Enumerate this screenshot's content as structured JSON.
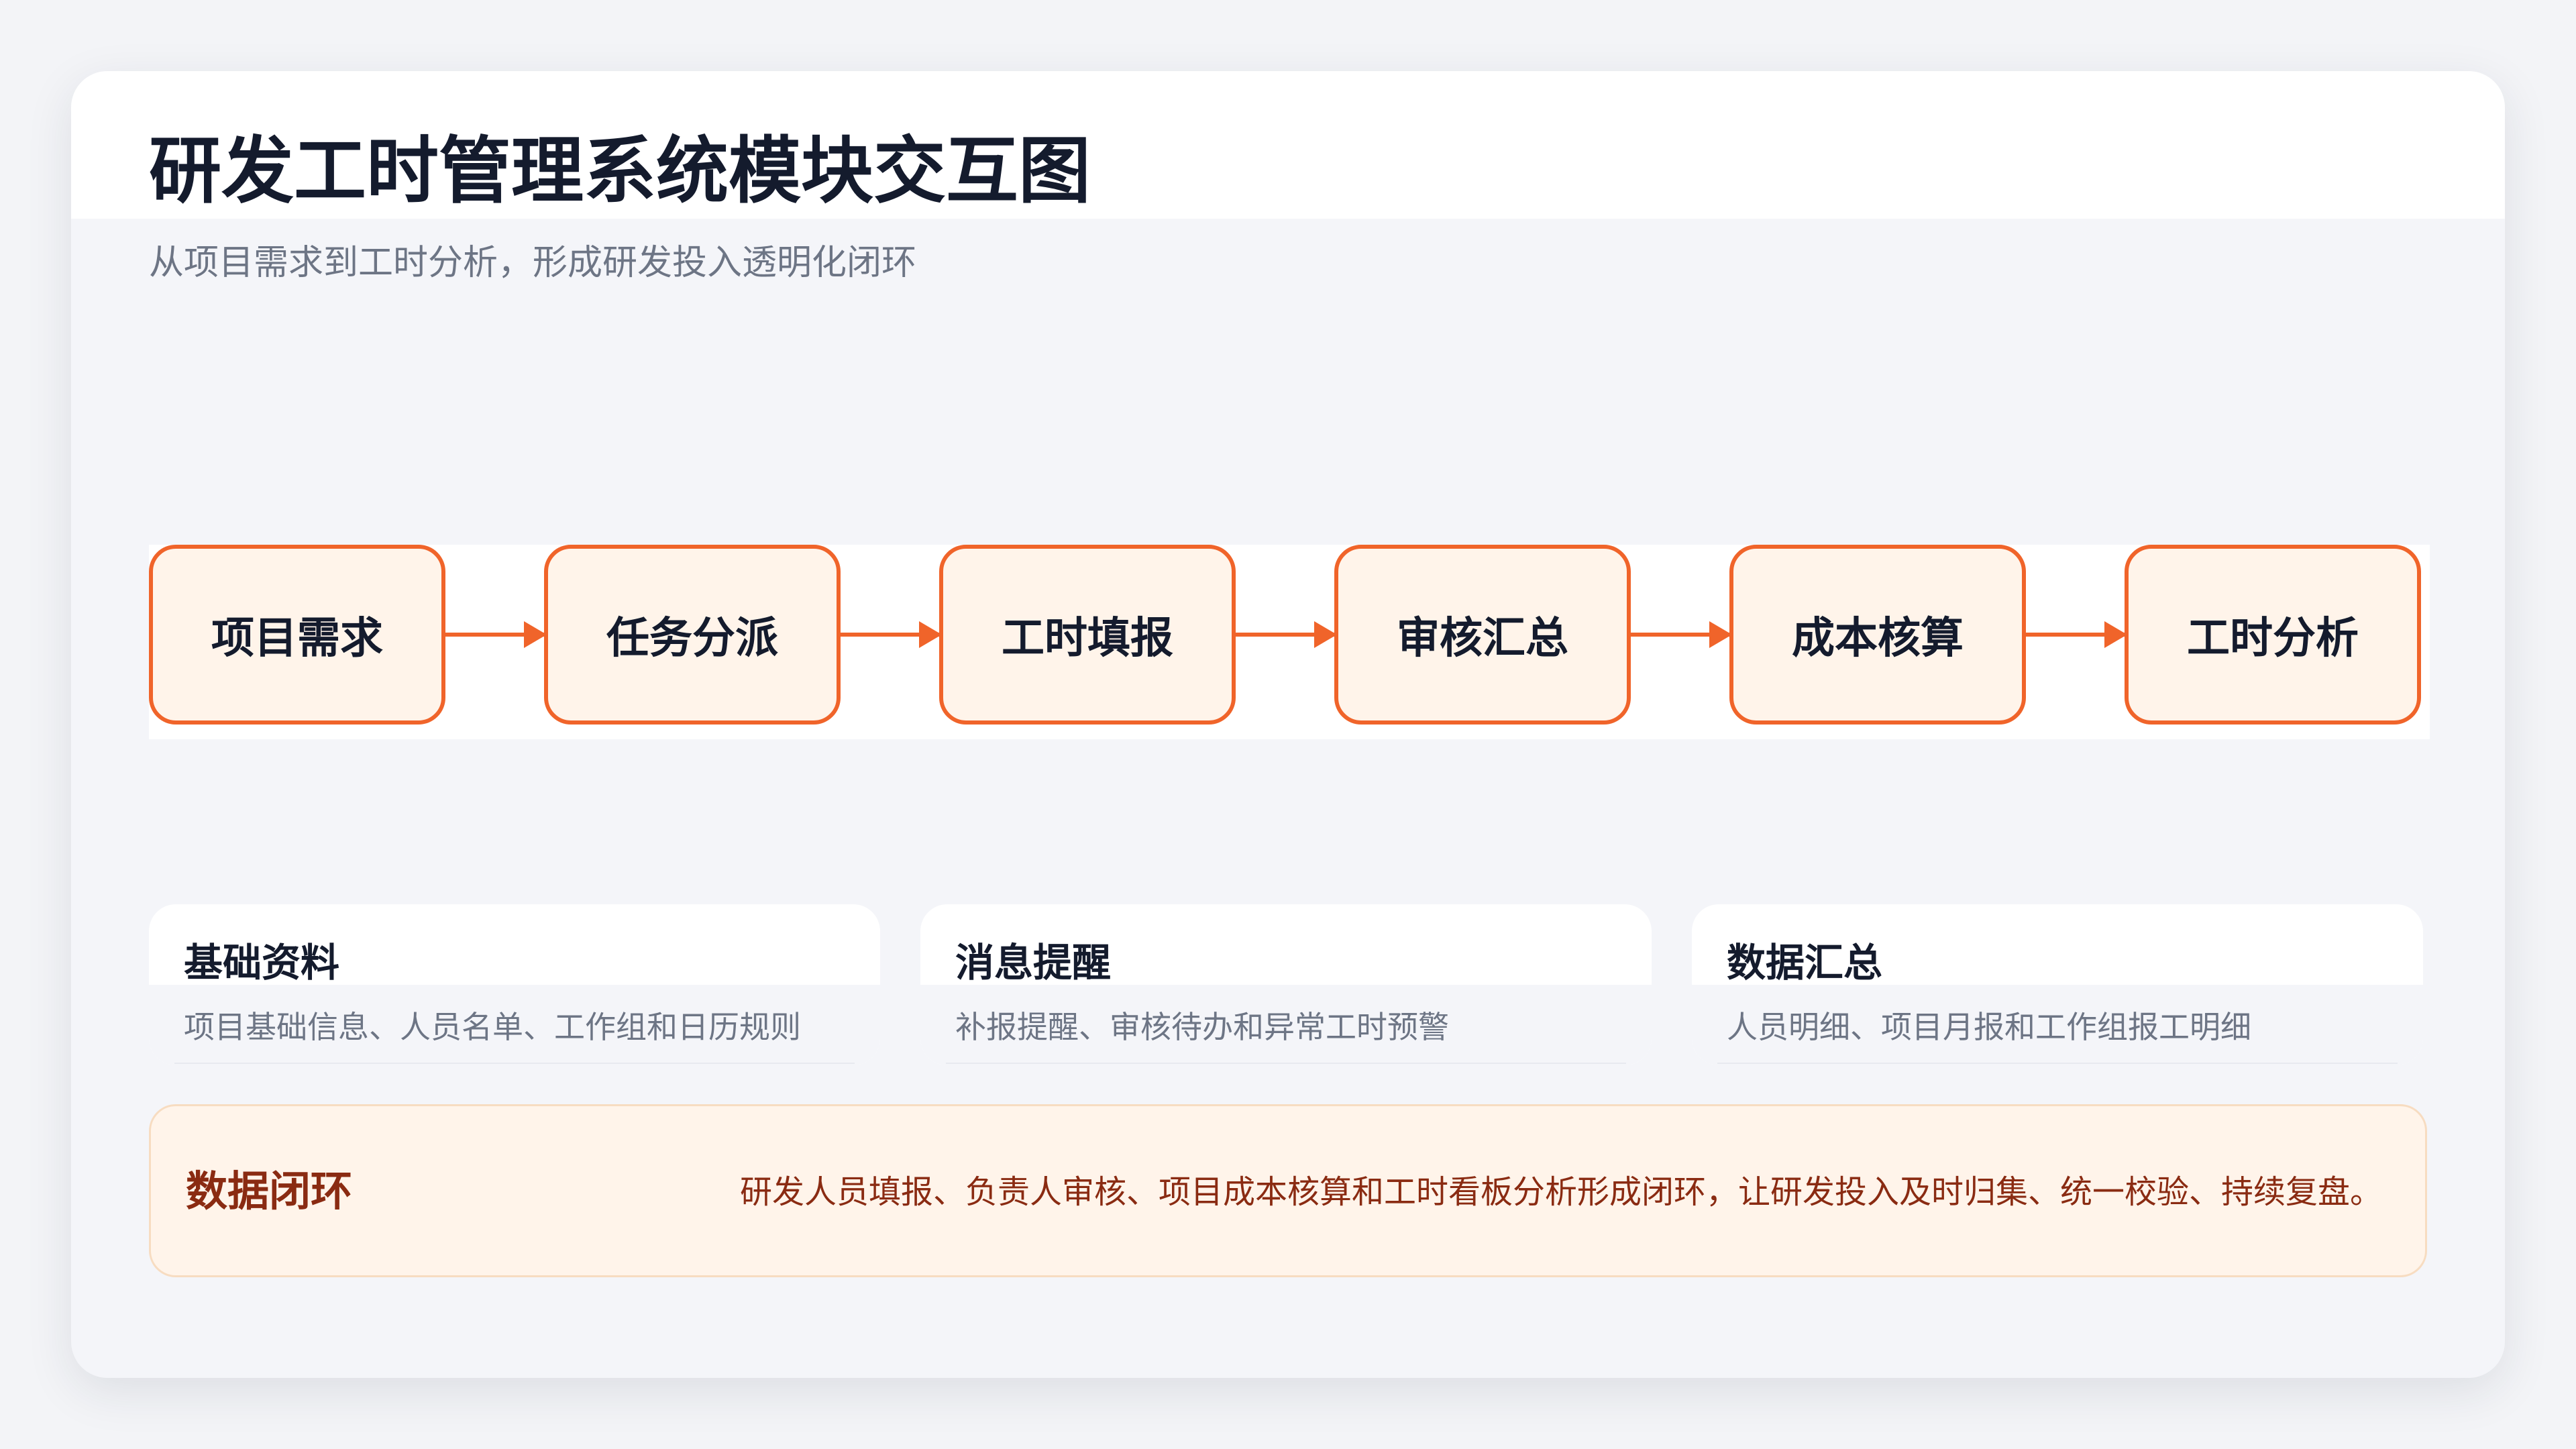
{
  "header": {
    "title": "研发工时管理系统模块交互图",
    "subtitle": "从项目需求到工时分析，形成研发投入透明化闭环"
  },
  "flow": {
    "nodes": [
      "项目需求",
      "任务分派",
      "工时填报",
      "审核汇总",
      "成本核算",
      "工时分析"
    ],
    "accent_color": "#f0642a",
    "node_fill": "#fff4ea"
  },
  "features": [
    {
      "title": "基础资料",
      "desc": "项目基础信息、人员名单、工作组和日历规则"
    },
    {
      "title": "消息提醒",
      "desc": "补报提醒、审核待办和异常工时预警"
    },
    {
      "title": "数据汇总",
      "desc": "人员明细、项目月报和工作组报工明细"
    }
  ],
  "loop": {
    "title": "数据闭环",
    "desc": "研发人员填报、负责人审核、项目成本核算和工时看板分析形成闭环，让研发投入及时归集、统一校验、持续复盘。",
    "text_color": "#8a2b12"
  }
}
